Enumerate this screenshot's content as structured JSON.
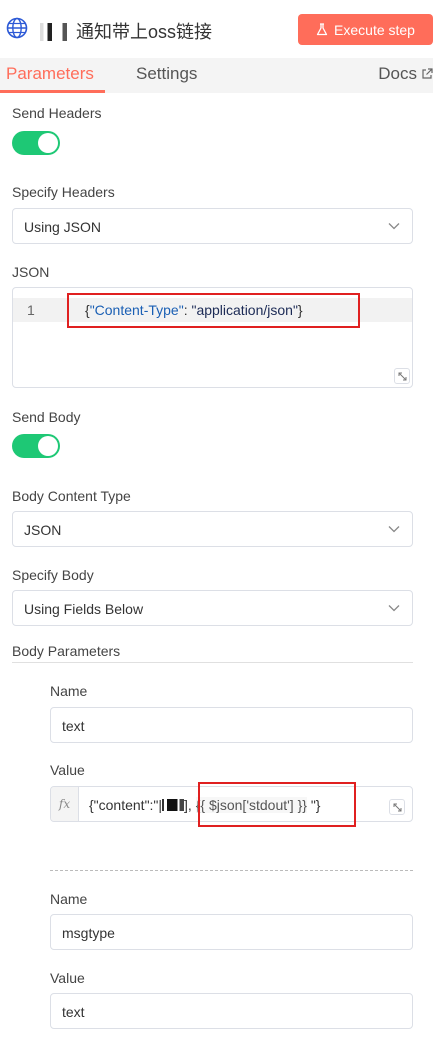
{
  "header": {
    "title": "通知带上oss链接",
    "execute_label": "Execute step"
  },
  "tabs": {
    "parameters": "Parameters",
    "settings": "Settings",
    "docs": "Docs"
  },
  "form": {
    "send_headers_label": "Send Headers",
    "send_headers_on": true,
    "specify_headers_label": "Specify Headers",
    "specify_headers_value": "Using JSON",
    "json_label": "JSON",
    "json_line_number": "1",
    "json_key": "\"Content-Type\"",
    "json_colon": ": ",
    "json_value": "\"application/json\"",
    "json_open": "{",
    "json_close": "}",
    "send_body_label": "Send Body",
    "send_body_on": true,
    "body_content_type_label": "Body Content Type",
    "body_content_type_value": "JSON",
    "specify_body_label": "Specify Body",
    "specify_body_value": "Using Fields Below",
    "body_parameters_label": "Body Parameters"
  },
  "body_parameters": [
    {
      "name_label": "Name",
      "name_value": "text",
      "value_label": "Value",
      "value_prefix": "{\"content\":\"|",
      "value_mid": "],",
      "value_expression": "{{ $json['stdout'] }}",
      "value_suffix": " \"}",
      "fx_label": "fx"
    },
    {
      "name_label": "Name",
      "name_value": "msgtype",
      "value_label": "Value",
      "value_value": "text"
    }
  ],
  "colors": {
    "accent": "#ff6d5a",
    "toggle_on": "#1ec875",
    "highlight_box": "#e02020"
  }
}
